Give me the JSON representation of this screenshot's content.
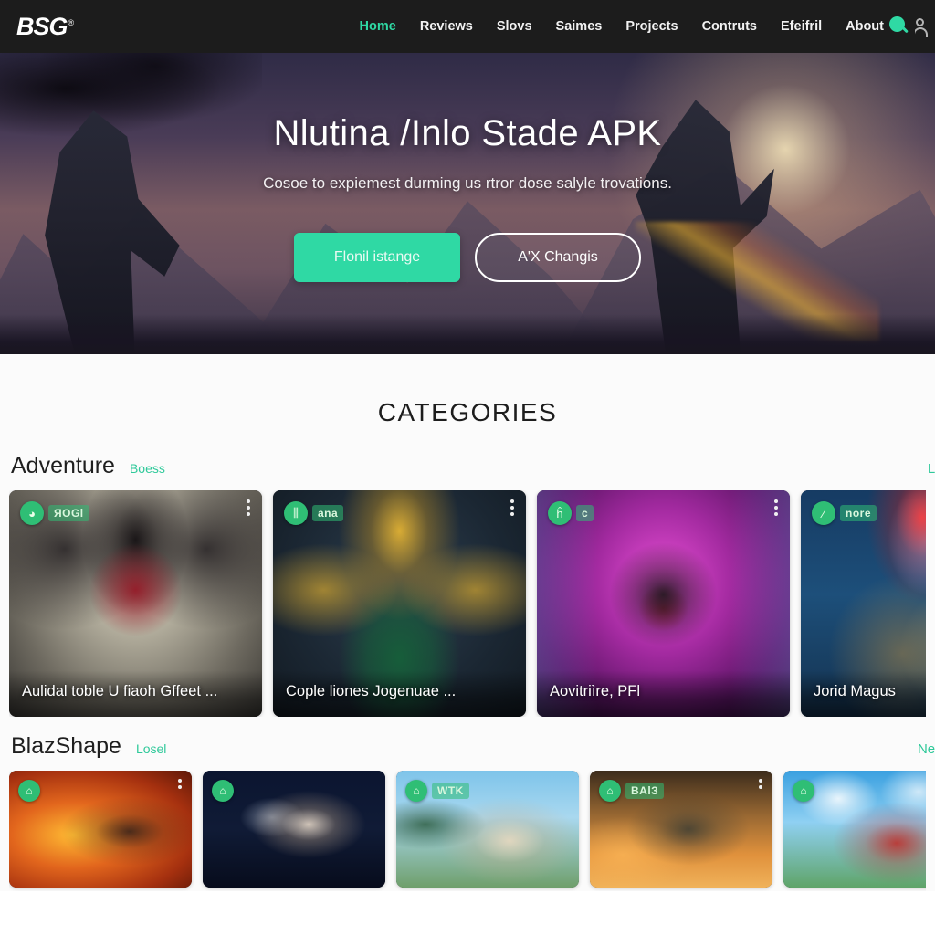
{
  "header": {
    "logo": "BSG",
    "logo_tm": "®",
    "nav": [
      {
        "label": "Home",
        "active": true
      },
      {
        "label": "Reviews",
        "active": false
      },
      {
        "label": "Slovs",
        "active": false
      },
      {
        "label": "Saimes",
        "active": false
      },
      {
        "label": "Projects",
        "active": false
      },
      {
        "label": "Contruts",
        "active": false
      },
      {
        "label": "Efeifril",
        "active": false
      },
      {
        "label": "About",
        "active": false
      }
    ],
    "icons": {
      "search": "search-icon",
      "account": "user-icon"
    }
  },
  "hero": {
    "title": "Nlutina /Inlo Stade APK",
    "subtitle": "Cosoe to expiemest durming us rtror dose salyle trovations.",
    "primary_button": "Flonil istange",
    "secondary_button": "A'X Changis"
  },
  "main": {
    "categories_heading": "CATEGORIES",
    "sections": [
      {
        "title": "Adventure",
        "tag": "Boess",
        "more": "Los",
        "cards": [
          {
            "title": "Aulidal toble U fiaoh Gffeet  ...",
            "badge_icon": "◕",
            "badge_text": "ЯOGl"
          },
          {
            "title": "Cople liones Jogenuae ...",
            "badge_icon": "⫼",
            "badge_text": "ana"
          },
          {
            "title": "Aovitriìre, PFl",
            "badge_icon": "ĥ",
            "badge_text": "c"
          },
          {
            "title": "Jorid Magus",
            "badge_icon": "⁄",
            "badge_text": "nore"
          }
        ]
      },
      {
        "title": "BlazShape",
        "tag": "Losel",
        "more": "Neve",
        "cards": [
          {
            "title": "",
            "badge_icon": "⌂",
            "badge_text": ""
          },
          {
            "title": "",
            "badge_icon": "⌂",
            "badge_text": ""
          },
          {
            "title": "",
            "badge_icon": "⌂",
            "badge_text": "WTK"
          },
          {
            "title": "",
            "badge_icon": "⌂",
            "badge_text": "BAlЗ"
          },
          {
            "title": "",
            "badge_icon": "⌂",
            "badge_text": ""
          }
        ]
      }
    ]
  },
  "colors": {
    "accent": "#2fd9a4",
    "accent_link": "#2fc99a",
    "header_bg": "#1c1c1c",
    "page_bg": "#fbfbfb",
    "badge_green": "#2fbe75"
  }
}
